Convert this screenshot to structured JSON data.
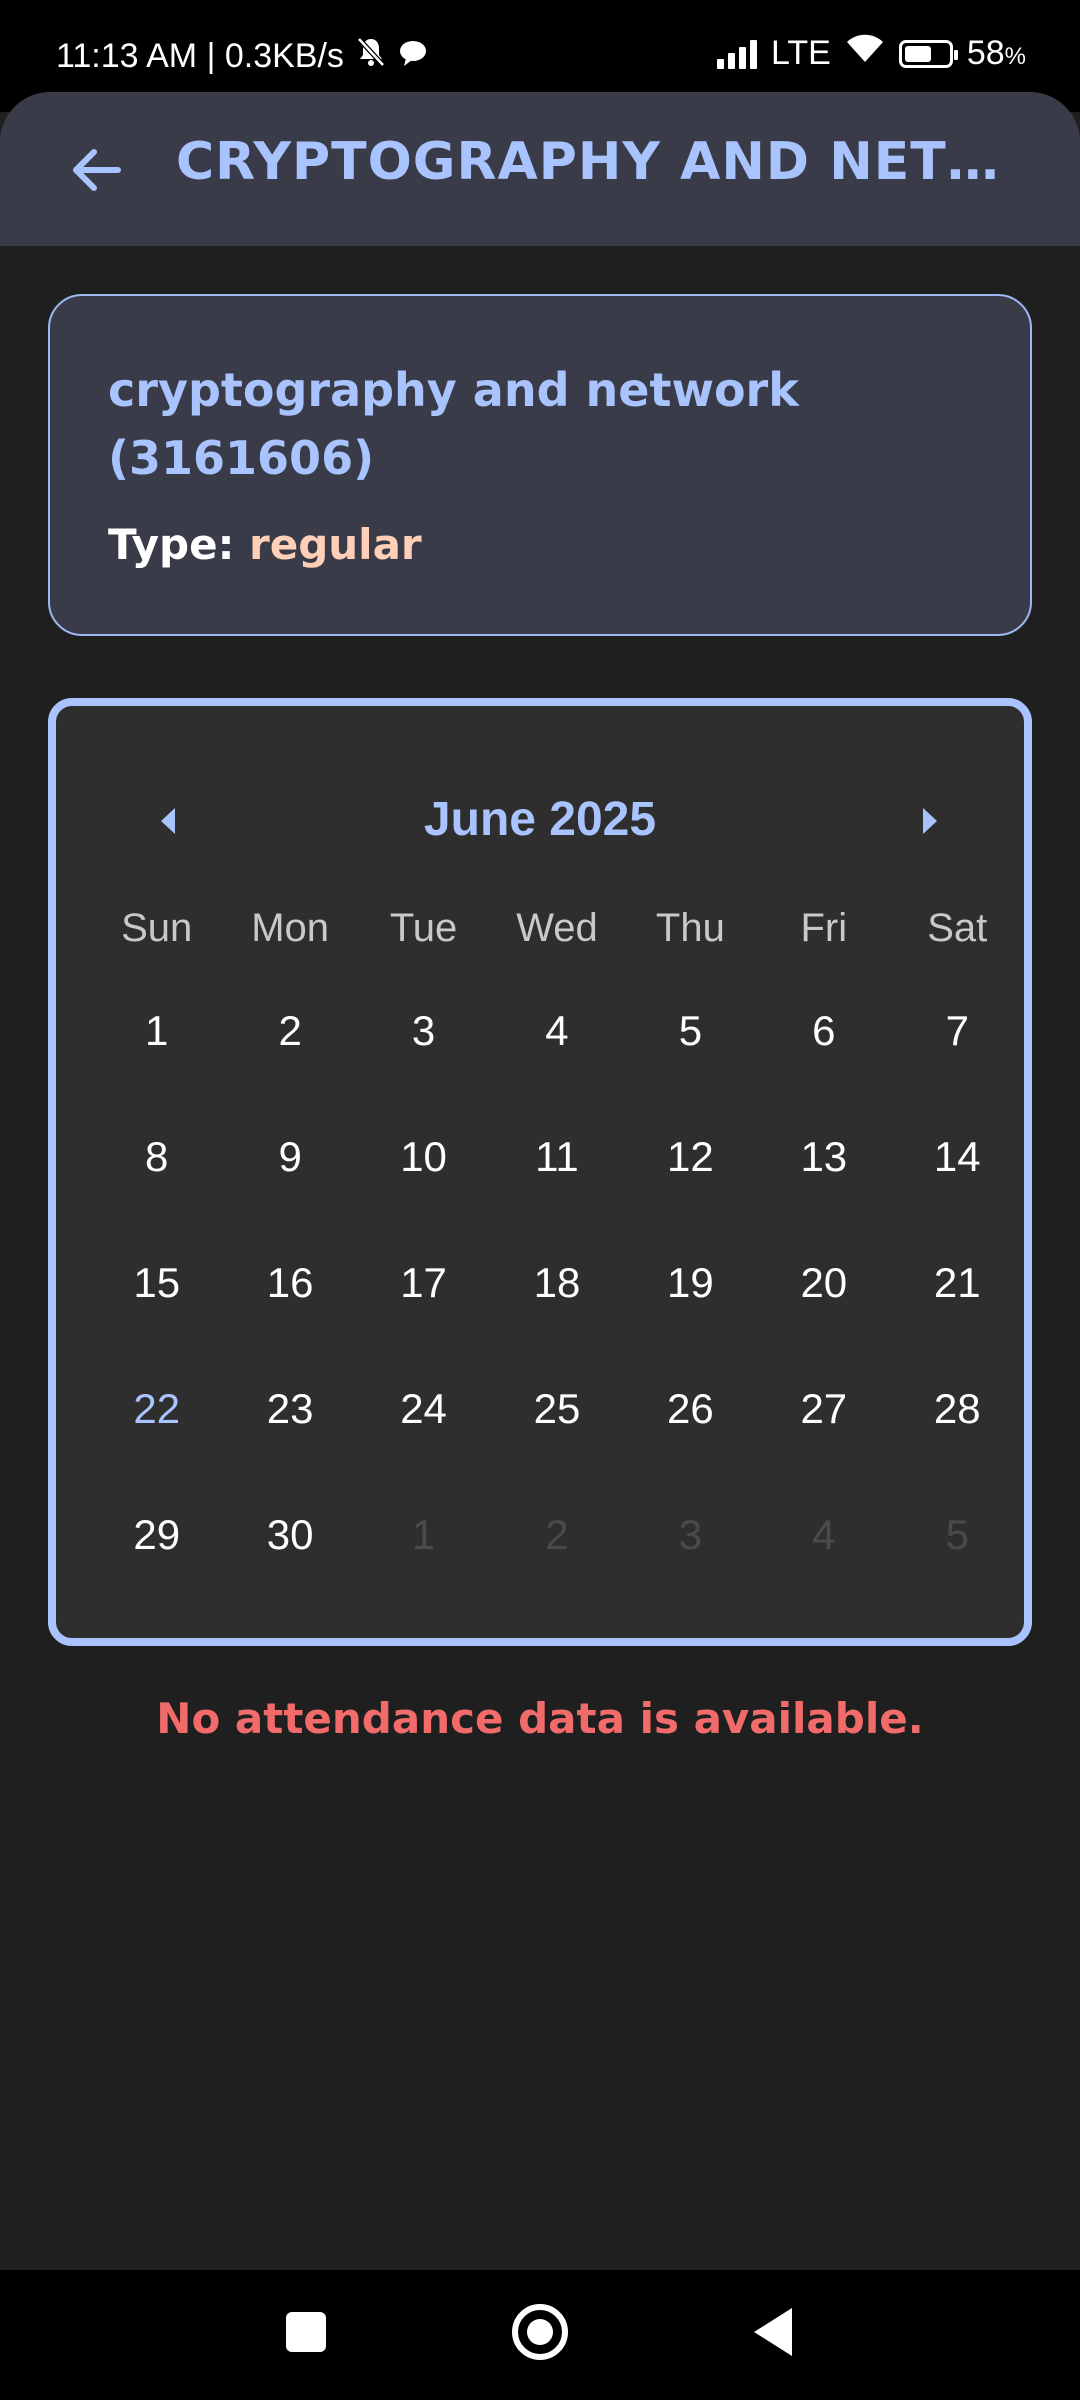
{
  "status_bar": {
    "time_network": "11:13 AM | 0.3KB/s",
    "network_type": "LTE",
    "battery": "58",
    "battery_unit": "%",
    "battery_level_percent": 58,
    "icons": [
      "mute-icon",
      "chat-icon",
      "signal-icon",
      "wifi-icon",
      "battery-icon"
    ]
  },
  "app_bar": {
    "title": "CRYPTOGRAPHY AND NETW...",
    "back_icon": "arrow-left-icon"
  },
  "course": {
    "name": "cryptography and network (3161606)",
    "type_label": "Type:",
    "type_value": "regular"
  },
  "calendar": {
    "month_title": "June 2025",
    "prev_icon": "caret-left-icon",
    "next_icon": "caret-right-icon",
    "weekdays": [
      "Sun",
      "Mon",
      "Tue",
      "Wed",
      "Thu",
      "Fri",
      "Sat"
    ],
    "weeks": [
      [
        "1",
        "2",
        "3",
        "4",
        "5",
        "6",
        "7"
      ],
      [
        "8",
        "9",
        "10",
        "11",
        "12",
        "13",
        "14"
      ],
      [
        "15",
        "16",
        "17",
        "18",
        "19",
        "20",
        "21"
      ],
      [
        "22",
        "23",
        "24",
        "25",
        "26",
        "27",
        "28"
      ],
      [
        "29",
        "30",
        "1",
        "2",
        "3",
        "4",
        "5"
      ]
    ],
    "today": "22",
    "colors": {
      "accent": "#a9c3ff",
      "card_bg": "#2e2e2e"
    }
  },
  "message": "No attendance data is available.",
  "colors": {
    "background": "#1f1f1f",
    "appbar": "#393c48",
    "accent": "#a9c3ff",
    "type_value": "#ffcfb8",
    "error": "#f26b6b"
  },
  "nav_bar": {
    "icons": [
      "recents-icon",
      "home-icon",
      "back-icon"
    ]
  }
}
